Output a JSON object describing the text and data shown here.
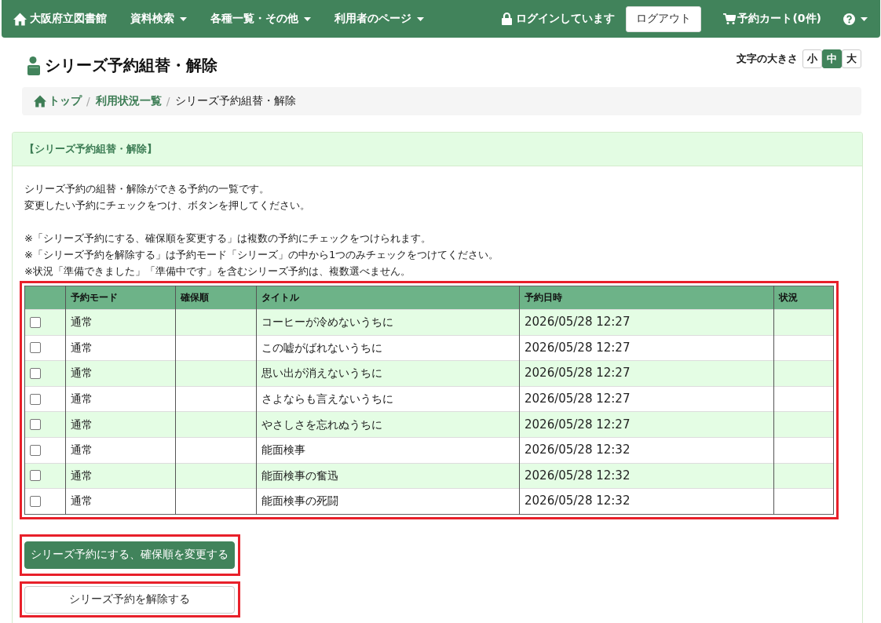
{
  "navbar": {
    "brand": "大阪府立図書館",
    "menus": [
      {
        "label": "資料検索",
        "dropdown": true
      },
      {
        "label": "各種一覧・その他",
        "dropdown": true
      },
      {
        "label": "利用者のページ",
        "dropdown": true
      }
    ],
    "login_status": "ログインしています",
    "logout_button": "ログアウト",
    "cart": "予約カート(0件)",
    "help": {
      "dropdown": true
    }
  },
  "page_title": "シリーズ予約組替・解除",
  "font_size": {
    "label": "文字の大きさ",
    "options": [
      {
        "label": "小",
        "selected": false
      },
      {
        "label": "中",
        "selected": true
      },
      {
        "label": "大",
        "selected": false
      }
    ]
  },
  "breadcrumb": {
    "separator": "/",
    "items": [
      {
        "label": "トップ",
        "kind": "home"
      },
      {
        "label": "利用状況一覧",
        "kind": "link"
      },
      {
        "label": "シリーズ予約組替・解除",
        "kind": "current"
      }
    ]
  },
  "panel": {
    "title": "【シリーズ予約組替・解除】",
    "intro": [
      "シリーズ予約の組替・解除ができる予約の一覧です。",
      "変更したい予約にチェックをつけ、ボタンを押してください。"
    ],
    "notes": [
      "※「シリーズ予約にする、確保順を変更する」は複数の予約にチェックをつけられます。",
      "※「シリーズ予約を解除する」は予約モード「シリーズ」の中から1つのみチェックをつけてください。",
      "※状況「準備できました」「準備中です」を含むシリーズ予約は、複数選べません。"
    ],
    "table": {
      "highlighted": true,
      "columns": [
        "予約モード",
        "確保順",
        "タイトル",
        "予約日時",
        "状況"
      ],
      "rows": [
        {
          "checked": false,
          "mode": "通常",
          "title": "コーヒーが冷めないうちに",
          "reserved_at": "2026/05/28 12:27"
        },
        {
          "checked": false,
          "mode": "通常",
          "title": "この嘘がばれないうちに",
          "reserved_at": "2026/05/28 12:27"
        },
        {
          "checked": false,
          "mode": "通常",
          "title": "思い出が消えないうちに",
          "reserved_at": "2026/05/28 12:27"
        },
        {
          "checked": false,
          "mode": "通常",
          "title": "さよならも言えないうちに",
          "reserved_at": "2026/05/28 12:27"
        },
        {
          "checked": false,
          "mode": "通常",
          "title": "やさしさを忘れぬうちに",
          "reserved_at": "2026/05/28 12:27"
        },
        {
          "checked": false,
          "mode": "通常",
          "title": "能面検事",
          "reserved_at": "2026/05/28 12:32"
        },
        {
          "checked": false,
          "mode": "通常",
          "title": "能面検事の奮迅",
          "reserved_at": "2026/05/28 12:32"
        },
        {
          "checked": false,
          "mode": "通常",
          "title": "能面検事の死闘",
          "reserved_at": "2026/05/28 12:32"
        }
      ]
    },
    "buttons": [
      {
        "label": "シリーズ予約にする、確保順を変更する",
        "kind": "primary",
        "highlighted": true
      },
      {
        "label": "シリーズ予約を解除する",
        "kind": "default",
        "highlighted": true
      }
    ]
  }
}
